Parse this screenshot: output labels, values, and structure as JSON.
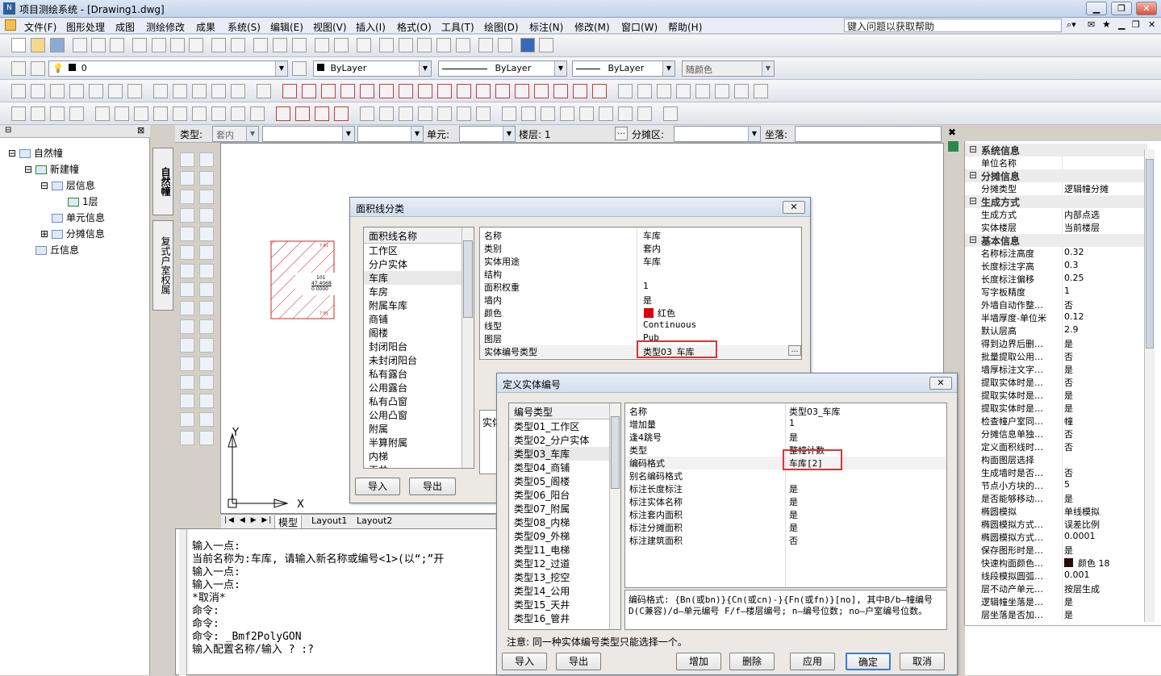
{
  "app": {
    "title": "项目测绘系统 - [Drawing1.dwg]",
    "help_placeholder": "键入问题以获取帮助"
  },
  "menu": [
    "文件(F)",
    "图形处理",
    "成图",
    "测绘修改",
    "成果",
    "系统(S)",
    "编辑(E)",
    "视图(V)",
    "插入(I)",
    "格式(O)",
    "工具(T)",
    "绘图(D)",
    "标注(N)",
    "修改(M)",
    "窗口(W)",
    "帮助(H)"
  ],
  "layers": {
    "current": "0",
    "color": "ByLayer",
    "linetype": "ByLayer",
    "lineweight": "ByLayer",
    "plot": "随颜色"
  },
  "typebar": {
    "type_label": "类型:",
    "type_value": "套内",
    "unit_label": "单元:",
    "floor_label": "楼层: 1",
    "share_label": "分摊区:",
    "seat_label": "坐落:"
  },
  "tree": {
    "root": "自然幢",
    "building": "新建幢",
    "floor_info": "层信息",
    "floor1": "1层",
    "unit_info": "单元信息",
    "share_info": "分摊信息",
    "hill_info": "丘信息"
  },
  "vtabs": [
    "自然幢",
    "复式户室权属"
  ],
  "drawing": {
    "room_num": "101",
    "area": "47.4068",
    "zero": "0.0000",
    "dim1": "7.81",
    "dim2": "7.81"
  },
  "layout_tabs": [
    "模型",
    "Layout1",
    "Layout2"
  ],
  "cmd_lines": [
    "输入一点:",
    "当前名称为:车库, 请输入新名称或编号<1>(以“;”开",
    "输入一点:",
    "输入一点:",
    "*取消*",
    "命令:",
    "命令:",
    "命令: _Bmf2PolyGON",
    "输入配置名称/输入 ? :?"
  ],
  "dlg1": {
    "title": "面积线分类",
    "list_header": "面积线名称",
    "items": [
      "工作区",
      "分户实体",
      "车库",
      "车房",
      "附属车库",
      "商铺",
      "阁楼",
      "封闭阳台",
      "未封闭阳台",
      "私有露台",
      "公用露台",
      "私有凸窗",
      "公用凸窗",
      "附属",
      "半算附属",
      "内梯",
      "天井"
    ],
    "selected": "车库",
    "props": [
      [
        "名称",
        "车库"
      ],
      [
        "类别",
        "套内"
      ],
      [
        "实体用途",
        "车库"
      ],
      [
        "结构",
        ""
      ],
      [
        "面积权重",
        "1"
      ],
      [
        "墙内",
        "是"
      ],
      [
        "颜色",
        "红色"
      ],
      [
        "线型",
        "Continuous"
      ],
      [
        "图层",
        "Pub"
      ],
      [
        "实体编号类型",
        "类型03_车库"
      ]
    ],
    "detail_label": "实体",
    "import": "导入",
    "export": "导出",
    "color_hex": "#e00000"
  },
  "dlg2": {
    "title": "定义实体编号",
    "list_header": "编号类型",
    "items": [
      "类型01_工作区",
      "类型02_分户实体",
      "类型03_车库",
      "类型04_商铺",
      "类型05_阁楼",
      "类型06_阳台",
      "类型07_附属",
      "类型08_内梯",
      "类型09_外梯",
      "类型11_电梯",
      "类型12_过道",
      "类型13_挖空",
      "类型14_公用",
      "类型15_天井",
      "类型16_管井"
    ],
    "selected": "类型03_车库",
    "props": [
      [
        "名称",
        "类型03_车库"
      ],
      [
        "增加量",
        "1"
      ],
      [
        "逢4跳号",
        "是"
      ],
      [
        "类型",
        "整幢计数"
      ],
      [
        "编码格式",
        "车库[2]"
      ],
      [
        "别名编码格式",
        ""
      ],
      [
        "标注长度标注",
        "是"
      ],
      [
        "标注实体名称",
        "是"
      ],
      [
        "标注套内面积",
        "是"
      ],
      [
        "标注分摊面积",
        "是"
      ],
      [
        "标注建筑面积",
        "否"
      ]
    ],
    "desc": "编码格式: {Bn(或bn)}{Cn(或cn)-}{Fn(或fn)}[no], 其中B/b—幢编号 D(C兼容)/d—单元编号 F/f—楼层编号; n—编号位数; no—户室编号位数。",
    "note": "注意: 同一种实体编号类型只能选择一个。",
    "import": "导入",
    "export": "导出",
    "add": "增加",
    "delete": "删除",
    "apply": "应用",
    "ok": "确定",
    "cancel": "取消"
  },
  "props_panel": [
    [
      "cat",
      "系统信息",
      ""
    ],
    [
      "row",
      "单位名称",
      ""
    ],
    [
      "cat",
      "分摊信息",
      ""
    ],
    [
      "row",
      "分摊类型",
      "逻辑幢分摊"
    ],
    [
      "cat",
      "生成方式",
      ""
    ],
    [
      "row",
      "生成方式",
      "内部点选"
    ],
    [
      "row",
      "实体楼层",
      "当前楼层"
    ],
    [
      "cat",
      "基本信息",
      ""
    ],
    [
      "row",
      "名称标注高度",
      "0.32"
    ],
    [
      "row",
      "长度标注字高",
      "0.3"
    ],
    [
      "row",
      "长度标注偏移",
      "0.25"
    ],
    [
      "row",
      "写字板精度",
      "1"
    ],
    [
      "row",
      "外墙自动作整…",
      "否"
    ],
    [
      "row",
      "半墙厚度-单位米",
      "0.12"
    ],
    [
      "row",
      "默认层高",
      "2.9"
    ],
    [
      "row",
      "得到边界后删…",
      "是"
    ],
    [
      "row",
      "批量提取公用…",
      "否"
    ],
    [
      "row",
      "墙厚标注文字…",
      "是"
    ],
    [
      "row",
      "提取实体时是…",
      "否"
    ],
    [
      "row",
      "提取实体时是…",
      "是"
    ],
    [
      "row",
      "提取实体时是…",
      "是"
    ],
    [
      "row",
      "检查幢户室同…",
      "幢"
    ],
    [
      "row",
      "分摊信息单独…",
      "否"
    ],
    [
      "row",
      "定义面积线时…",
      "否"
    ],
    [
      "row",
      "构面图层选择",
      ""
    ],
    [
      "row",
      "生成墙时是否…",
      "否"
    ],
    [
      "row",
      "节点小方块的…",
      "5"
    ],
    [
      "row",
      "是否能够移动…",
      "是"
    ],
    [
      "row",
      "椭圆模拟",
      "单线模拟"
    ],
    [
      "row",
      "椭圆模拟方式…",
      "误差比例"
    ],
    [
      "row",
      "椭圆模拟方式…",
      "0.0001"
    ],
    [
      "row",
      "保存图形时是…",
      "是"
    ],
    [
      "row",
      "快速构面颜色…",
      "颜色 18"
    ],
    [
      "row",
      "线段模拟圆弧…",
      "0.001"
    ],
    [
      "row",
      "层不动产单元…",
      "按层生成"
    ],
    [
      "row",
      "逻辑幢坐落是…",
      "是"
    ],
    [
      "row",
      "层坐落是否加…",
      "是"
    ]
  ]
}
